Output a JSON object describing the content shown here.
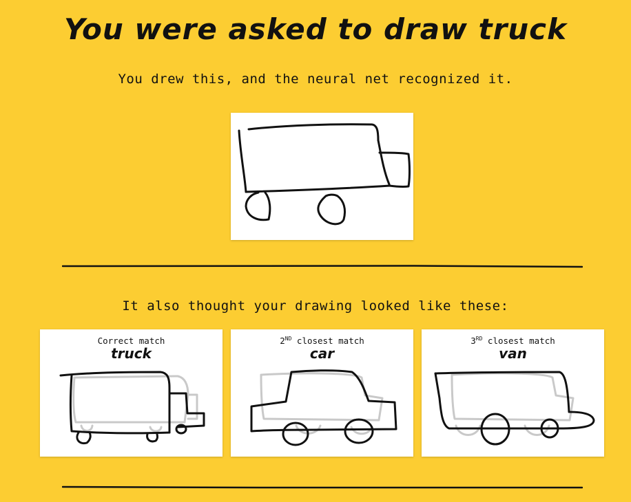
{
  "header": {
    "title": "You were asked to draw truck",
    "result_text": "You drew this, and the neural net recognized it."
  },
  "drawing": {
    "subject": "truck-drawing"
  },
  "matches_section": {
    "heading": "It also thought your drawing looked like these:",
    "cards": [
      {
        "rank_label": "Correct match",
        "rank_num": "",
        "rank_sup": "",
        "rank_suffix": "",
        "name": "truck"
      },
      {
        "rank_label": "",
        "rank_num": "2",
        "rank_sup": "ND",
        "rank_suffix": " closest match",
        "name": "car"
      },
      {
        "rank_label": "",
        "rank_num": "3",
        "rank_sup": "RD",
        "rank_suffix": " closest match",
        "name": "van"
      }
    ]
  },
  "colors": {
    "background": "#fccd32",
    "ink": "#111111",
    "ghost": "#c9c9c9"
  }
}
